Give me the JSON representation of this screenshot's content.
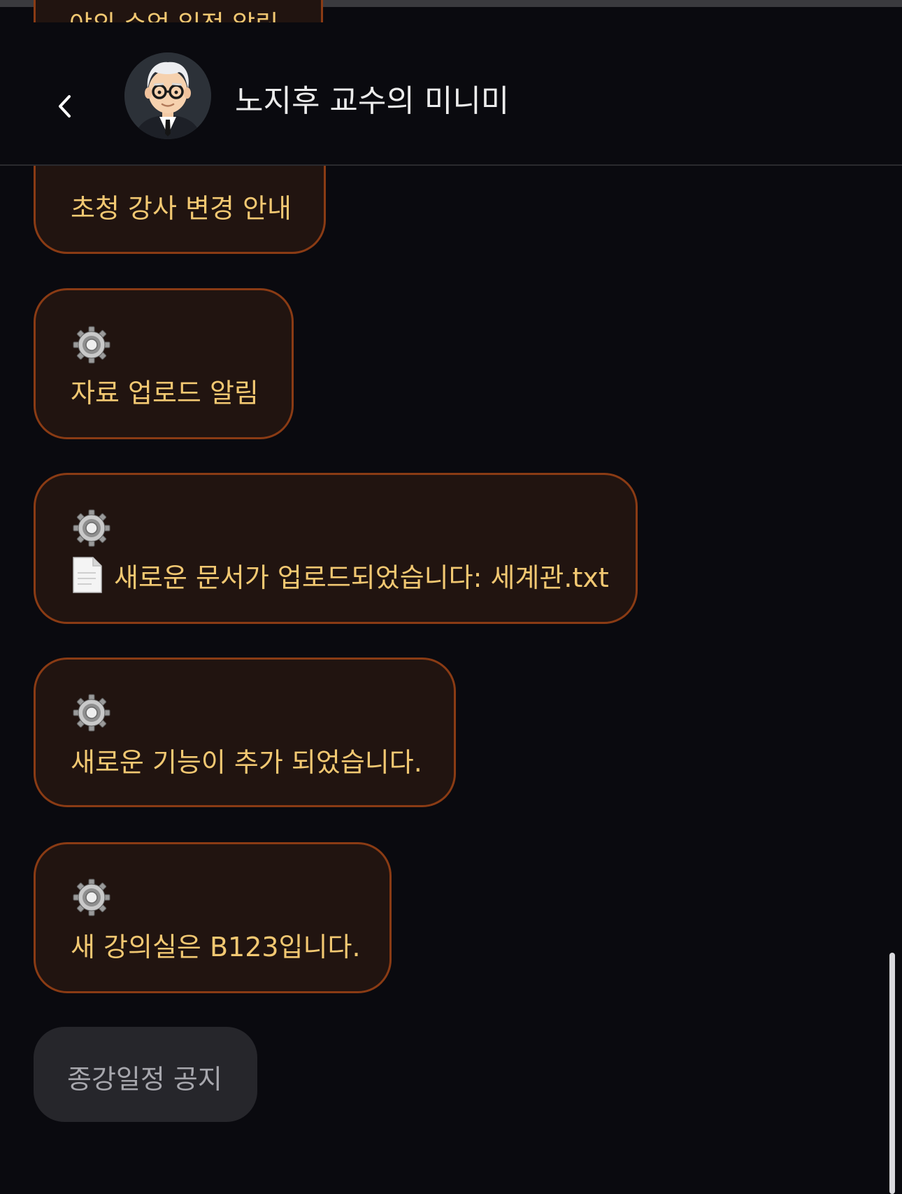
{
  "header": {
    "title": "노지후 교수의 미니미",
    "back_icon": "chevron-left-icon",
    "avatar_icon": "professor-avatar-icon"
  },
  "messages": [
    {
      "text": "야외 수업 일정 알림",
      "icon": "gear-icon"
    },
    {
      "text": "초청 강사 변경 안내",
      "icon": "gear-icon"
    },
    {
      "text": "자료 업로드 알림",
      "icon": "gear-icon"
    },
    {
      "text": "새로운 문서가 업로드되었습니다: 세계관.txt",
      "icon": "gear-icon",
      "attachment_icon": "document-icon"
    },
    {
      "text": "새로운 기능이 추가 되었습니다.",
      "icon": "gear-icon"
    },
    {
      "text": "새 강의실은 B123입니다.",
      "icon": "gear-icon"
    }
  ],
  "suggestion": {
    "label": "종강일정 공지"
  },
  "colors": {
    "background": "#0a0a0f",
    "bubble_bg": "#211410",
    "bubble_border": "#8a3b14",
    "bubble_text": "#f2c872",
    "chip_bg": "#26262b",
    "chip_text": "#a7a7ad"
  }
}
